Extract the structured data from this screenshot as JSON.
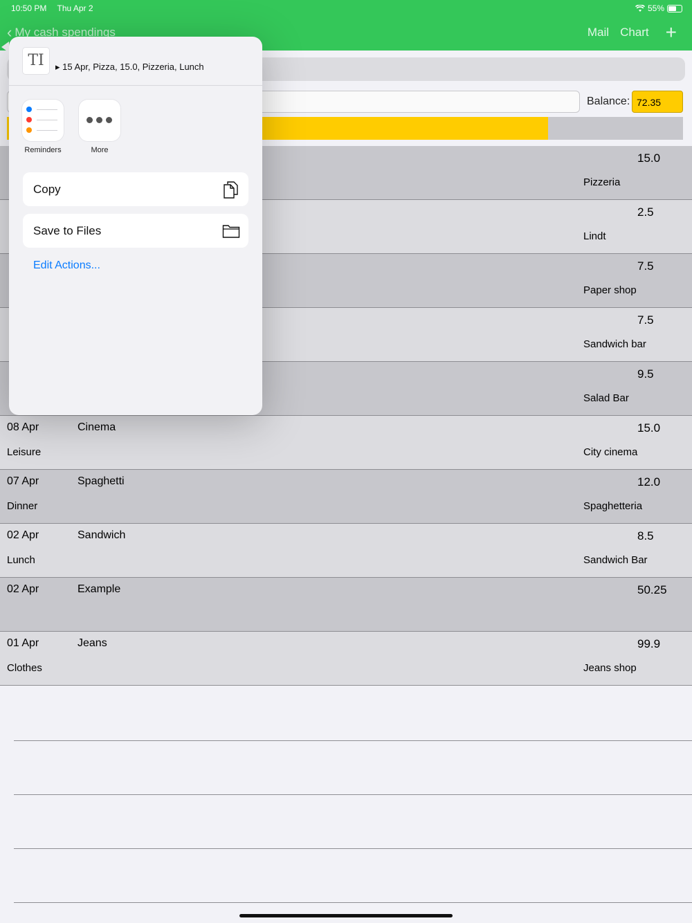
{
  "status": {
    "time": "10:50 PM",
    "date": "Thu Apr 2",
    "battery": "55%"
  },
  "nav": {
    "back_label": "My cash spendings",
    "mail_label": "Mail",
    "chart_label": "Chart",
    "add_icon": "plus-icon"
  },
  "balance": {
    "label": "Balance:",
    "value": "72.35",
    "progress_fraction": 0.8
  },
  "rows": [
    {
      "date": "",
      "item": "",
      "category": "",
      "amount": "15.0",
      "place": "Pizzeria",
      "shade": "dark"
    },
    {
      "date": "",
      "item": "",
      "category": "",
      "amount": "2.5",
      "place": "Lindt",
      "shade": "light"
    },
    {
      "date": "",
      "item": "",
      "category": "",
      "amount": "7.5",
      "place": "Paper shop",
      "shade": "dark"
    },
    {
      "date": "",
      "item": "",
      "category": "",
      "amount": "7.5",
      "place": "Sandwich bar",
      "shade": "light"
    },
    {
      "date": "",
      "item": "",
      "category": "",
      "amount": "9.5",
      "place": "Salad Bar",
      "shade": "dark"
    },
    {
      "date": "08 Apr",
      "item": "Cinema",
      "category": "Leisure",
      "amount": "15.0",
      "place": "City cinema",
      "shade": "light"
    },
    {
      "date": "07 Apr",
      "item": "Spaghetti",
      "category": "Dinner",
      "amount": "12.0",
      "place": "Spaghetteria",
      "shade": "dark"
    },
    {
      "date": "02 Apr",
      "item": "Sandwich",
      "category": "Lunch",
      "amount": "8.5",
      "place": "Sandwich Bar",
      "shade": "light"
    },
    {
      "date": "02 Apr",
      "item": "Example",
      "category": "",
      "amount": "50.25",
      "place": "",
      "shade": "dark"
    },
    {
      "date": "01 Apr",
      "item": "Jeans",
      "category": "Clothes",
      "amount": "99.9",
      "place": "Jeans shop",
      "shade": "light"
    }
  ],
  "share": {
    "title": "▸ 15 Apr, Pizza, 15.0, Pizzeria, Lunch",
    "apps": [
      {
        "name": "Reminders",
        "icon": "reminders-icon"
      },
      {
        "name": "More",
        "icon": "more-icon"
      }
    ],
    "actions": [
      {
        "label": "Copy",
        "icon": "copy-icon"
      },
      {
        "label": "Save to Files",
        "icon": "folder-icon"
      }
    ],
    "edit_label": "Edit Actions..."
  }
}
